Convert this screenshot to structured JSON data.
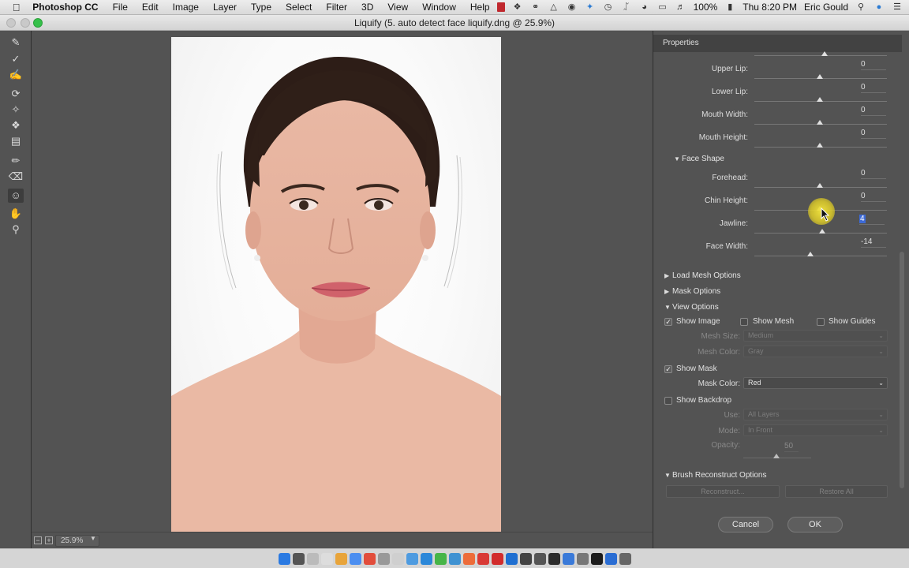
{
  "menubar": {
    "app_name": "Photoshop CC",
    "items": [
      "File",
      "Edit",
      "Image",
      "Layer",
      "Type",
      "Select",
      "Filter",
      "3D",
      "View",
      "Window",
      "Help"
    ],
    "battery": "100%",
    "clock": "Thu 8:20 PM",
    "user": "Eric Gould"
  },
  "window": {
    "title": "Liquify (5. auto detect face liquify.dng @ 25.9%)"
  },
  "status": {
    "zoom": "25.9%"
  },
  "properties": {
    "header": "Properties",
    "mouth_sliders": [
      {
        "label": "Upper Lip:",
        "value": "0"
      },
      {
        "label": "Lower Lip:",
        "value": "0"
      },
      {
        "label": "Mouth Width:",
        "value": "0"
      },
      {
        "label": "Mouth Height:",
        "value": "0"
      }
    ],
    "face_shape": {
      "title": "Face Shape",
      "sliders": [
        {
          "label": "Forehead:",
          "value": "0"
        },
        {
          "label": "Chin Height:",
          "value": "0"
        },
        {
          "label": "Jawline:",
          "value": "4"
        },
        {
          "label": "Face Width:",
          "value": "-14"
        }
      ]
    },
    "sections": {
      "load_mesh": "Load Mesh Options",
      "mask_options": "Mask Options",
      "view_options": "View Options",
      "brush_reconstruct": "Brush Reconstruct Options"
    },
    "view_options": {
      "show_image": {
        "label": "Show Image",
        "checked": true
      },
      "show_mesh": {
        "label": "Show Mesh",
        "checked": false
      },
      "show_guides": {
        "label": "Show Guides",
        "checked": false
      },
      "mesh_size_label": "Mesh Size:",
      "mesh_size_value": "Medium",
      "mesh_color_label": "Mesh Color:",
      "mesh_color_value": "Gray",
      "show_mask": {
        "label": "Show Mask",
        "checked": true
      },
      "mask_color_label": "Mask Color:",
      "mask_color_value": "Red",
      "show_backdrop": {
        "label": "Show Backdrop",
        "checked": false
      },
      "use_label": "Use:",
      "use_value": "All Layers",
      "mode_label": "Mode:",
      "mode_value": "In Front",
      "opacity_label": "Opacity:",
      "opacity_value": "50"
    },
    "brush_reconstruct": {
      "reconstruct": "Reconstruct...",
      "restore_all": "Restore All"
    }
  },
  "dialog": {
    "cancel": "Cancel",
    "ok": "OK"
  },
  "colors": {
    "panel_bg": "#535353",
    "accent_highlight": "#3d6ad6",
    "cursor_highlight": "#f0dc3a"
  }
}
